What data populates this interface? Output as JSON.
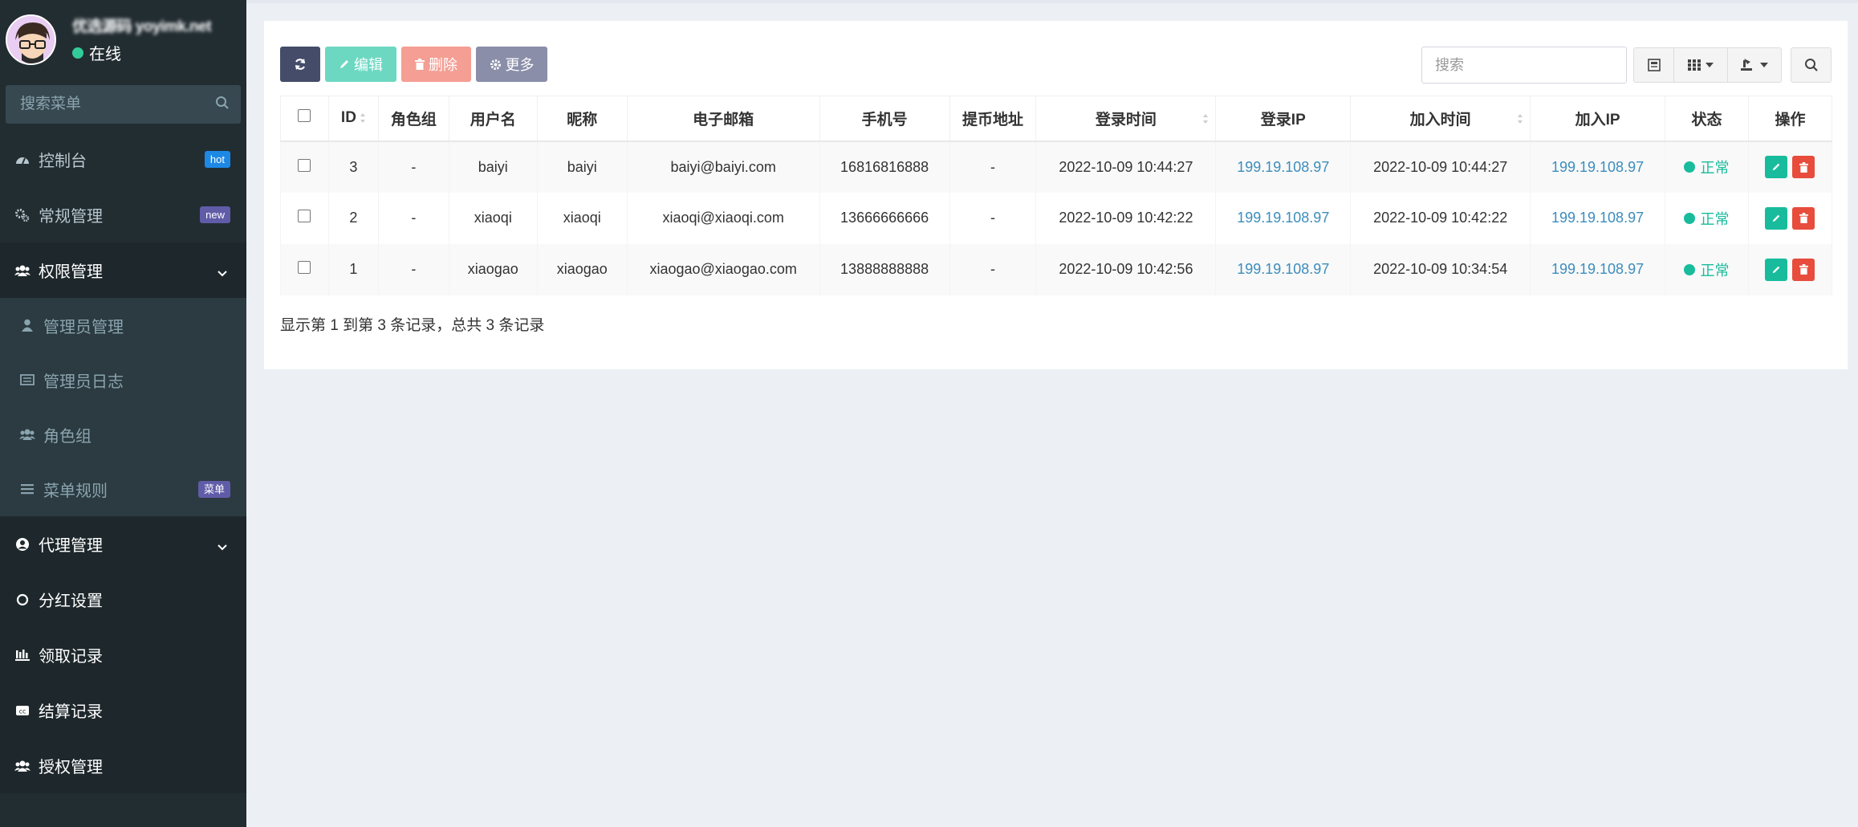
{
  "user": {
    "name": "优选源码 yoyimk.net",
    "status": "在线"
  },
  "sidebar": {
    "search_placeholder": "搜索菜单",
    "items": [
      {
        "label": "控制台",
        "badge": "hot",
        "badge_color": "#1e88e5",
        "icon": "dashboard-icon"
      },
      {
        "label": "常规管理",
        "badge": "new",
        "badge_color": "#605ca8",
        "icon": "cogs-icon"
      },
      {
        "label": "权限管理",
        "icon": "group-icon",
        "open": true
      },
      {
        "label": "管理员管理",
        "icon": "user-icon",
        "sub": true
      },
      {
        "label": "管理员日志",
        "icon": "list-alt-icon",
        "sub": true
      },
      {
        "label": "角色组",
        "icon": "group-icon",
        "sub": true
      },
      {
        "label": "菜单规则",
        "badge": "菜单",
        "badge_color": "#605ca8",
        "icon": "bars-icon",
        "sub": true
      },
      {
        "label": "代理管理",
        "icon": "user-circle-icon"
      },
      {
        "label": "分红设置",
        "icon": "circle-icon"
      },
      {
        "label": "领取记录",
        "icon": "align-icon"
      },
      {
        "label": "结算记录",
        "icon": "cc-icon"
      },
      {
        "label": "授权管理",
        "icon": "group-icon"
      }
    ]
  },
  "toolbar": {
    "edit": "编辑",
    "delete": "删除",
    "more": "更多",
    "search_placeholder": "搜索"
  },
  "table": {
    "headers": [
      "ID",
      "角色组",
      "用户名",
      "昵称",
      "电子邮箱",
      "手机号",
      "提币地址",
      "登录时间",
      "登录IP",
      "加入时间",
      "加入IP",
      "状态",
      "操作"
    ],
    "rows": [
      {
        "id": "3",
        "group": "-",
        "username": "baiyi",
        "nickname": "baiyi",
        "email": "baiyi@baiyi.com",
        "mobile": "16816816888",
        "address": "-",
        "logintime": "2022-10-09 10:44:27",
        "loginip": "199.19.108.97",
        "jointime": "2022-10-09 10:44:27",
        "joinip": "199.19.108.97",
        "status": "正常"
      },
      {
        "id": "2",
        "group": "-",
        "username": "xiaoqi",
        "nickname": "xiaoqi",
        "email": "xiaoqi@xiaoqi.com",
        "mobile": "13666666666",
        "address": "-",
        "logintime": "2022-10-09 10:42:22",
        "loginip": "199.19.108.97",
        "jointime": "2022-10-09 10:42:22",
        "joinip": "199.19.108.97",
        "status": "正常"
      },
      {
        "id": "1",
        "group": "-",
        "username": "xiaogao",
        "nickname": "xiaogao",
        "email": "xiaogao@xiaogao.com",
        "mobile": "13888888888",
        "address": "-",
        "logintime": "2022-10-09 10:42:56",
        "loginip": "199.19.108.97",
        "jointime": "2022-10-09 10:34:54",
        "joinip": "199.19.108.97",
        "status": "正常"
      }
    ]
  },
  "pagination": {
    "text": "显示第 1 到第 3 条记录，总共 3 条记录"
  }
}
